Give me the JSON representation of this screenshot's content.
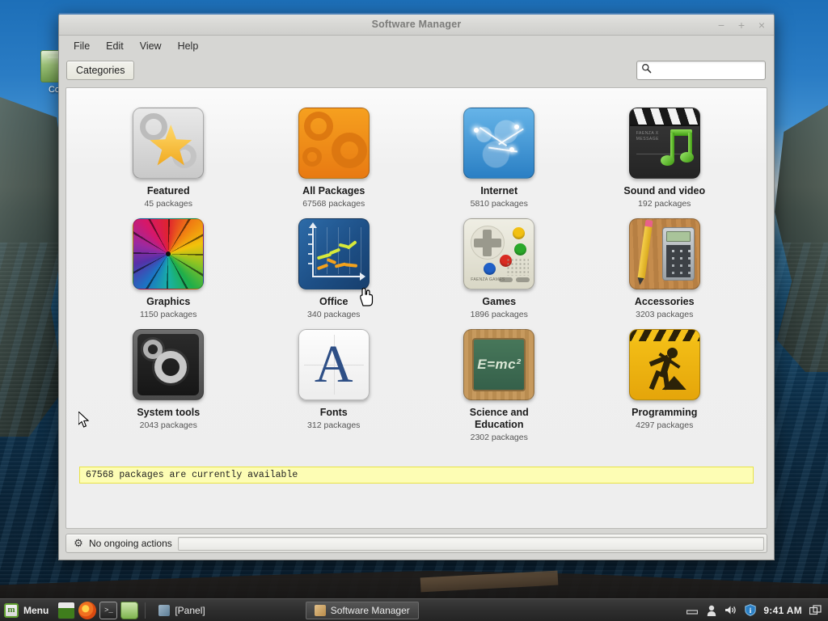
{
  "window": {
    "title": "Software Manager",
    "controls": {
      "minimize": "−",
      "maximize": "+",
      "close": "×"
    },
    "menus": [
      "File",
      "Edit",
      "View",
      "Help"
    ],
    "toolbar": {
      "categories_label": "Categories",
      "search_value": "",
      "search_placeholder": "",
      "search_icon": "search-icon"
    },
    "infobar": {
      "text": "67568 packages are currently available"
    },
    "statusbar": {
      "icon": "gear-icon",
      "text": "No ongoing actions",
      "progress": 0
    }
  },
  "categories": [
    {
      "name": "Featured",
      "count": "45 packages",
      "icon": "featured-star-icon"
    },
    {
      "name": "All Packages",
      "count": "67568 packages",
      "icon": "all-packages-gears-icon"
    },
    {
      "name": "Internet",
      "count": "5810 packages",
      "icon": "internet-globe-icon"
    },
    {
      "name": "Sound and video",
      "count": "192 packages",
      "icon": "sound-video-note-icon"
    },
    {
      "name": "Graphics",
      "count": "1150 packages",
      "icon": "graphics-colorwheel-icon"
    },
    {
      "name": "Office",
      "count": "340 packages",
      "icon": "office-chart-icon"
    },
    {
      "name": "Games",
      "count": "1896 packages",
      "icon": "games-gamepad-icon"
    },
    {
      "name": "Accessories",
      "count": "3203 packages",
      "icon": "accessories-calculator-icon"
    },
    {
      "name": "System tools",
      "count": "2043 packages",
      "icon": "system-tools-cogs-icon"
    },
    {
      "name": "Fonts",
      "count": "312 packages",
      "icon": "fonts-letter-a-icon"
    },
    {
      "name": "Science and Education",
      "count": "2302 packages",
      "icon": "science-chalkboard-icon"
    },
    {
      "name": "Programming",
      "count": "4297 packages",
      "icon": "programming-worker-icon"
    }
  ],
  "science_board_text": "E=mc²",
  "fonts_glyph": "A",
  "desktop": {
    "icon_label": "Co"
  },
  "taskbar": {
    "menu_label": "Menu",
    "mint_glyph": "m",
    "launchers": [
      "show-desktop-icon",
      "firefox-icon",
      "terminal-icon",
      "file-manager-icon"
    ],
    "terminal_glyph": ">_",
    "tasks": [
      {
        "label": "[Panel]",
        "icon": "panel-icon",
        "active": false
      },
      {
        "label": "Software Manager",
        "icon": "software-manager-icon",
        "active": true
      }
    ],
    "tray": {
      "keyboard": "⌴",
      "user": "●",
      "volume": "◂",
      "shield": "i",
      "clock": "9:41 AM",
      "workspace": "❐"
    }
  },
  "colors": {
    "accent": "#4a7fb5",
    "window_bg": "#d6d6d3",
    "info_bg": "#fdfdb4",
    "info_border": "#e8e246",
    "taskbar_bg": "#2e2e2e"
  }
}
